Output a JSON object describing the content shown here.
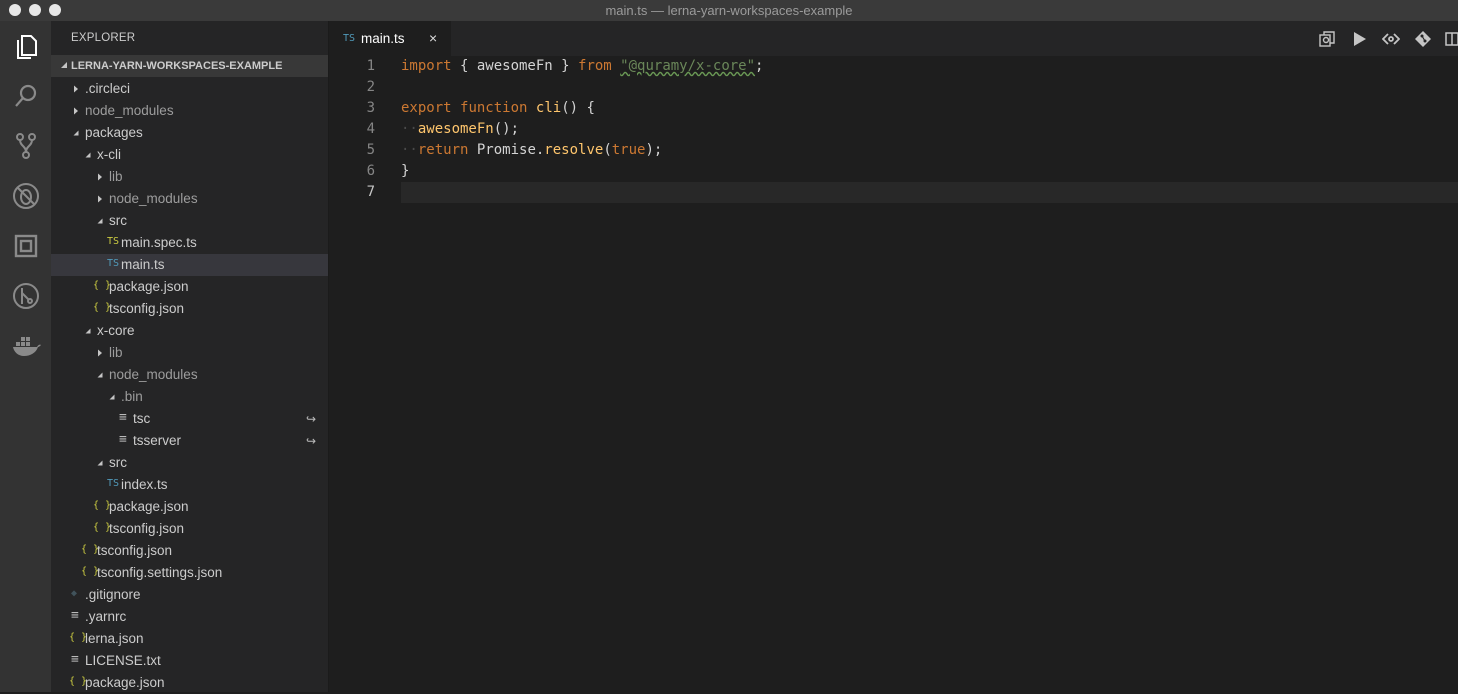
{
  "window": {
    "title": "main.ts — lerna-yarn-workspaces-example"
  },
  "activity_bar": {
    "icons": [
      "files-icon",
      "search-icon",
      "source-control-icon",
      "debug-icon",
      "extensions-icon",
      "gitlens-icon",
      "docker-icon"
    ]
  },
  "sidebar": {
    "header": "EXPLORER",
    "project": "LERNA-YARN-WORKSPACES-EXAMPLE",
    "tree": [
      {
        "label": ".circleci",
        "depth": 0,
        "kind": "folder",
        "open": false
      },
      {
        "label": "node_modules",
        "depth": 0,
        "kind": "folder",
        "open": false,
        "dim": true
      },
      {
        "label": "packages",
        "depth": 0,
        "kind": "folder",
        "open": true
      },
      {
        "label": "x-cli",
        "depth": 1,
        "kind": "folder",
        "open": true
      },
      {
        "label": "lib",
        "depth": 2,
        "kind": "folder",
        "open": false,
        "dim": true
      },
      {
        "label": "node_modules",
        "depth": 2,
        "kind": "folder",
        "open": false,
        "dim": true
      },
      {
        "label": "src",
        "depth": 2,
        "kind": "folder",
        "open": true
      },
      {
        "label": "main.spec.ts",
        "depth": 3,
        "kind": "ts-spec"
      },
      {
        "label": "main.ts",
        "depth": 3,
        "kind": "ts",
        "selected": true
      },
      {
        "label": "package.json",
        "depth": 2,
        "kind": "json"
      },
      {
        "label": "tsconfig.json",
        "depth": 2,
        "kind": "json"
      },
      {
        "label": "x-core",
        "depth": 1,
        "kind": "folder",
        "open": true
      },
      {
        "label": "lib",
        "depth": 2,
        "kind": "folder",
        "open": false,
        "dim": true
      },
      {
        "label": "node_modules",
        "depth": 2,
        "kind": "folder",
        "open": true,
        "dim": true
      },
      {
        "label": ".bin",
        "depth": 3,
        "kind": "folder",
        "open": true,
        "dim": true
      },
      {
        "label": "tsc",
        "depth": 4,
        "kind": "text",
        "symlink": true
      },
      {
        "label": "tsserver",
        "depth": 4,
        "kind": "text",
        "symlink": true
      },
      {
        "label": "src",
        "depth": 2,
        "kind": "folder",
        "open": true
      },
      {
        "label": "index.ts",
        "depth": 3,
        "kind": "ts"
      },
      {
        "label": "package.json",
        "depth": 2,
        "kind": "json"
      },
      {
        "label": "tsconfig.json",
        "depth": 2,
        "kind": "json"
      },
      {
        "label": "tsconfig.json",
        "depth": 1,
        "kind": "json"
      },
      {
        "label": "tsconfig.settings.json",
        "depth": 1,
        "kind": "json"
      },
      {
        "label": ".gitignore",
        "depth": 0,
        "kind": "git"
      },
      {
        "label": ".yarnrc",
        "depth": 0,
        "kind": "text"
      },
      {
        "label": "lerna.json",
        "depth": 0,
        "kind": "json"
      },
      {
        "label": "LICENSE.txt",
        "depth": 0,
        "kind": "text"
      },
      {
        "label": "package.json",
        "depth": 0,
        "kind": "json"
      }
    ]
  },
  "editor": {
    "tab": {
      "label": "main.ts",
      "badge": "TS",
      "close": "×"
    },
    "toolbar_icons": [
      "open-changes-icon",
      "run-icon",
      "gitlens-compare-icon",
      "git-icon",
      "split-editor-icon"
    ],
    "line_numbers": [
      "1",
      "2",
      "3",
      "4",
      "5",
      "6",
      "7"
    ],
    "active_line": "7",
    "code": {
      "l1": {
        "t1": "import",
        "t2": " { awesomeFn } ",
        "t3": "from",
        "t4": " ",
        "t5": "\"@quramy/x-core\"",
        "t6": ";"
      },
      "l3": {
        "t1": "export",
        "t2": " ",
        "t3": "function",
        "t4": " ",
        "t5": "cli",
        "t6": "() {"
      },
      "l4": {
        "ws": "··",
        "t1": "awesomeFn",
        "t2": "();"
      },
      "l5": {
        "ws": "··",
        "t1": "return",
        "t2": " Promise.",
        "t3": "resolve",
        "t4": "(",
        "t5": "true",
        "t6": ");"
      },
      "l6": {
        "t1": "}"
      }
    }
  },
  "colors": {
    "keyword": "#cc7832",
    "string": "#6a8759",
    "function": "#ffc66d",
    "ts_badge": "#519aba",
    "json_badge": "#cbcb41"
  }
}
